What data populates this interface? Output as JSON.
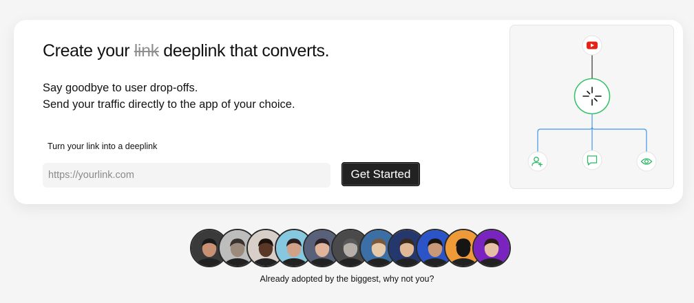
{
  "hero": {
    "headline_before": "Create your",
    "headline_struck": "link",
    "headline_after": "deeplink that converts.",
    "subline_1": "Say goodbye to user drop-offs.",
    "subline_2": "Send your traffic directly to the app of your choice."
  },
  "form": {
    "label": "Turn your link into a deeplink",
    "input_value": "",
    "input_placeholder": "https://yourlink.com",
    "button_label": "Get Started"
  },
  "diagram": {
    "source_icon": "youtube-icon",
    "hub_icon": "deeplink-hub-icon",
    "outputs": [
      "add-user-icon",
      "chat-bubble-icon",
      "eye-icon"
    ],
    "colors": {
      "youtube": "#e62117",
      "hub_border": "#37c26a",
      "branch_lines": "#3d97e8",
      "output_icons": "#2fb866"
    }
  },
  "social_proof": {
    "avatars": [
      {
        "name": "avatar-1",
        "bg": "#3a3a3a",
        "skin": "#c89174",
        "hair": "#1a1a1a"
      },
      {
        "name": "avatar-2",
        "bg": "#bdbdbd",
        "skin": "#9c8a7c",
        "hair": "#3a3230"
      },
      {
        "name": "avatar-3",
        "bg": "#d8d0c8",
        "skin": "#5a3828",
        "hair": "#1e140f"
      },
      {
        "name": "avatar-4",
        "bg": "#86c8e0",
        "skin": "#d1a288",
        "hair": "#2a2020"
      },
      {
        "name": "avatar-5",
        "bg": "#58607a",
        "skin": "#e0b49a",
        "hair": "#2a2028"
      },
      {
        "name": "avatar-6",
        "bg": "#4a4a4a",
        "skin": "#b5b0aa",
        "hair": "#5a5a5a"
      },
      {
        "name": "avatar-7",
        "bg": "#3b6fa6",
        "skin": "#e6c9a8",
        "hair": "#7a5a3a"
      },
      {
        "name": "avatar-8",
        "bg": "#24386e",
        "skin": "#e0b896",
        "hair": "#3a2a1e"
      },
      {
        "name": "avatar-9",
        "bg": "#2a54c8",
        "skin": "#c89878",
        "hair": "#1a1410"
      },
      {
        "name": "avatar-10",
        "bg": "#ef9a38",
        "skin": "#151515",
        "hair": "#151515"
      },
      {
        "name": "avatar-11",
        "bg": "#7a24c0",
        "skin": "#e6c0a4",
        "hair": "#2a1c14"
      }
    ],
    "tagline": "Already adopted by the biggest, why not you?"
  }
}
